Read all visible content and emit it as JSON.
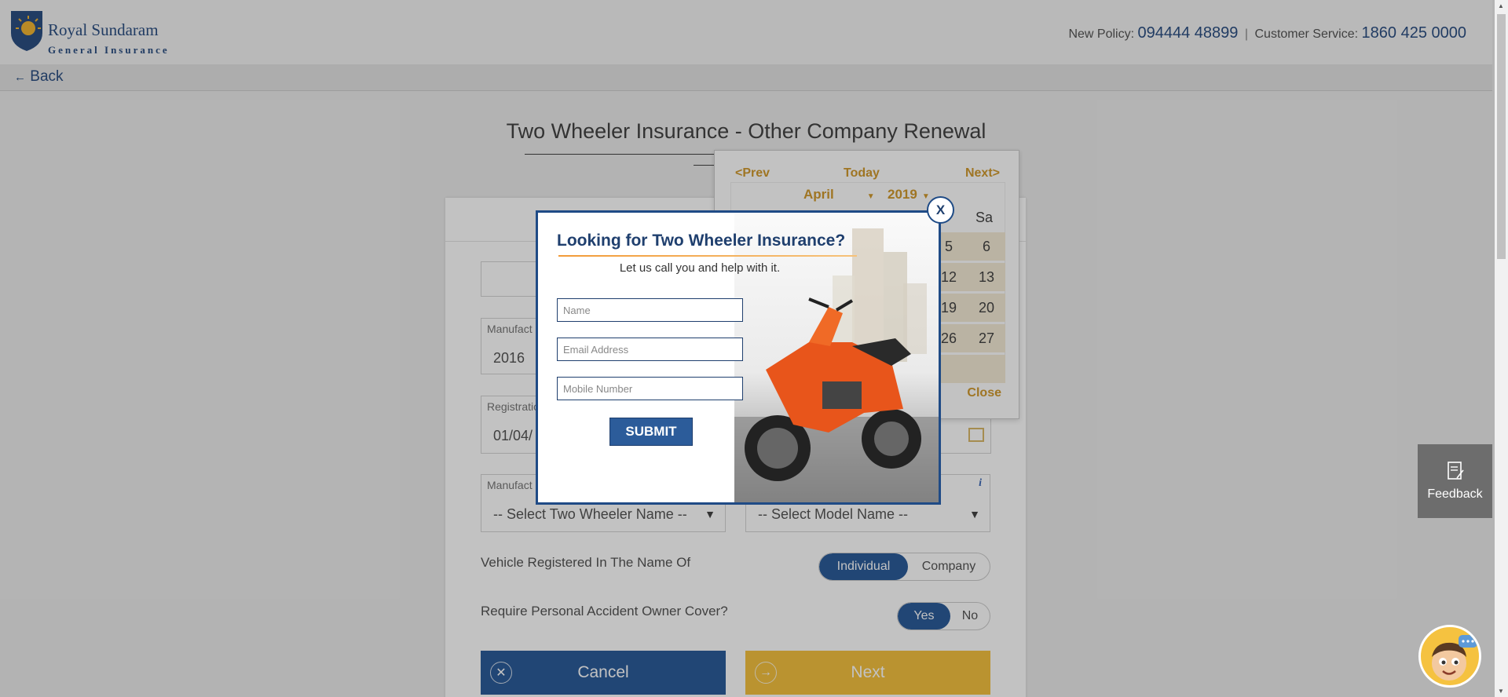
{
  "header": {
    "logo_name": "Royal Sundaram",
    "logo_sub": "General Insurance",
    "new_policy_label": "New Policy:",
    "new_policy_number": "094444 48899",
    "separator": "|",
    "customer_service_label": "Customer Service:",
    "customer_service_number": "1860 425 0000"
  },
  "nav": {
    "back_label": "Back"
  },
  "main": {
    "title": "Two Wheeler Insurance - Other Company Renewal",
    "manufacture_label": "Manufact",
    "manufacture_year": "2016",
    "registration_label": "Registratio",
    "registration_value": "01/04/",
    "manufacturer_label": "Manufact",
    "two_wheeler_select": "-- Select Two Wheeler Name --",
    "model_select": "-- Select Model Name --",
    "info_icon_glyph": "i",
    "q_registered": "Vehicle Registered In The Name Of",
    "opt_individual": "Individual",
    "opt_company": "Company",
    "q_pa_cover": "Require Personal Accident Owner Cover?",
    "opt_yes": "Yes",
    "opt_no": "No",
    "cancel_label": "Cancel",
    "next_label": "Next"
  },
  "datepicker": {
    "prev": "<Prev",
    "today": "Today",
    "next": "Next>",
    "month": "April",
    "year": "2019",
    "dow_sa": "Sa",
    "visible_days": [
      "5",
      "6",
      "12",
      "13",
      "19",
      "20",
      "26",
      "27"
    ],
    "close": "Close"
  },
  "popup": {
    "title": "Looking for Two Wheeler Insurance?",
    "subtitle": "Let us call you and help with it.",
    "name_placeholder": "Name",
    "email_placeholder": "Email Address",
    "mobile_placeholder": "Mobile Number",
    "submit_label": "SUBMIT",
    "close_label": "X"
  },
  "feedback": {
    "label": "Feedback"
  },
  "icons": [
    "logo-shield-icon",
    "back-arrow-icon",
    "calendar-icon",
    "info-icon",
    "caret-down-icon",
    "close-circle-icon",
    "arrow-circle-icon",
    "feedback-icon",
    "chatbot-icon",
    "scroll-up-icon",
    "scroll-down-icon"
  ],
  "colors": {
    "brand_blue": "#2c5c9a",
    "brand_gold": "#f5c240",
    "datepicker_accent": "#d29a2e",
    "popup_border": "#1f4b86"
  }
}
